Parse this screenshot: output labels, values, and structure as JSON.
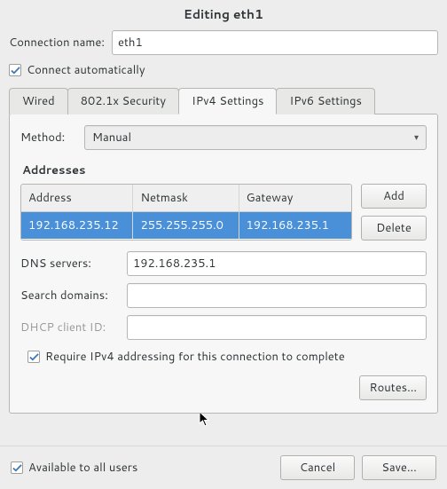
{
  "title": "Editing eth1",
  "connection_name": {
    "label": "Connection name:",
    "value": "eth1"
  },
  "connect_auto": {
    "checked": true,
    "label": "Connect automatically"
  },
  "tabs": [
    {
      "label": "Wired",
      "active": false
    },
    {
      "label": "802.1x Security",
      "active": false
    },
    {
      "label": "IPv4 Settings",
      "active": true
    },
    {
      "label": "IPv6 Settings",
      "active": false
    }
  ],
  "method": {
    "label": "Method:",
    "value": "Manual"
  },
  "addresses": {
    "heading": "Addresses",
    "columns": {
      "address": "Address",
      "netmask": "Netmask",
      "gateway": "Gateway"
    },
    "rows": [
      {
        "address": "192.168.235.12",
        "netmask": "255.255.255.0",
        "gateway": "192.168.235.1",
        "selected": true
      }
    ],
    "buttons": {
      "add": "Add",
      "delete": "Delete"
    }
  },
  "dns": {
    "label": "DNS servers:",
    "value": "192.168.235.1"
  },
  "search": {
    "label": "Search domains:",
    "value": ""
  },
  "dhcp": {
    "label": "DHCP client ID:",
    "value": ""
  },
  "require_ipv4": {
    "checked": true,
    "label": "Require IPv4 addressing for this connection to complete"
  },
  "routes_button": "Routes...",
  "available_all": {
    "checked": true,
    "label": "Available to all users"
  },
  "footer": {
    "cancel": "Cancel",
    "save": "Save..."
  }
}
